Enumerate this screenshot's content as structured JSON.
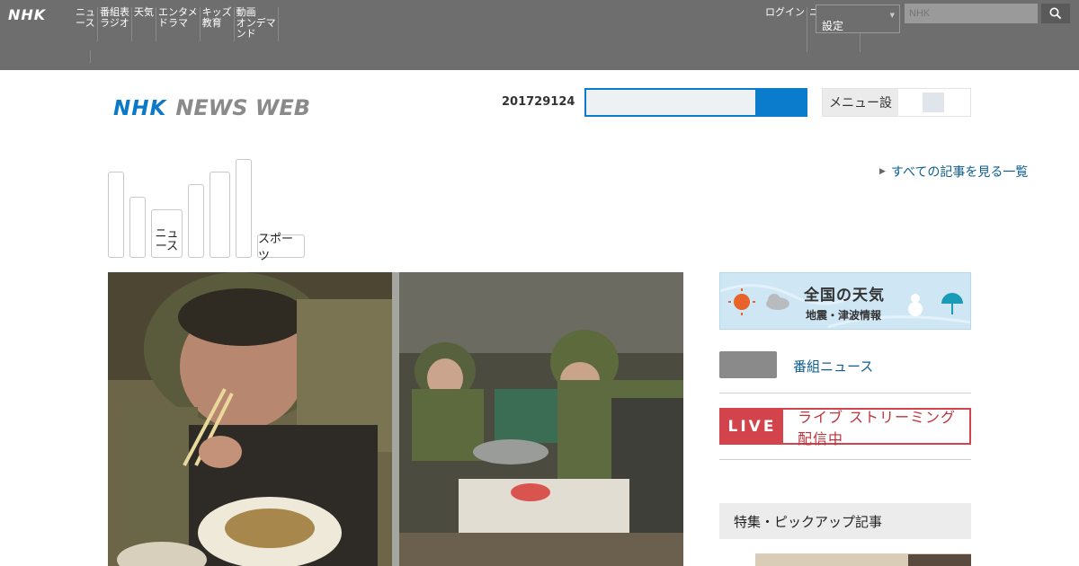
{
  "global_header": {
    "logo": "NHK",
    "nav_items": [
      [
        "ニュ",
        "ース"
      ],
      [
        "番組表",
        "ラジオ"
      ],
      [
        "天気"
      ],
      [
        "エンタメ",
        "ドラマ"
      ],
      [
        "キッズ",
        "教育"
      ],
      [
        "動画",
        "オンデマ",
        "ンド"
      ]
    ],
    "right_items": [
      [
        "ログ",
        "イン"
      ],
      [
        "ニュー",
        "スレ"
      ]
    ],
    "select_value": "設定",
    "search_placeholder": "NHK"
  },
  "site_header": {
    "logo_nhk": "NHK",
    "logo_newsweb": "NEWS WEB",
    "date": "201729124",
    "menu_button_label": "メニュー設"
  },
  "tabs": [
    {
      "label": ""
    },
    {
      "label": ""
    },
    {
      "label": "ニュ\nース"
    },
    {
      "label": ""
    },
    {
      "label": ""
    },
    {
      "label": ""
    },
    {
      "label": "スポーツ"
    }
  ],
  "more_link": "すべての記事を見る一覧",
  "weather_banner": {
    "title": "全国の天気",
    "subtitle": "地震・津波情報"
  },
  "side_link": "番組ニュース",
  "live": {
    "tag": "LIVE",
    "text": "ライブ ストリーミング配信中"
  },
  "section_head": "特集・ピックアップ記事",
  "colors": {
    "accent": "#0b7ccc",
    "live_red": "#d2434c",
    "header_gray": "#6e6e6e"
  }
}
